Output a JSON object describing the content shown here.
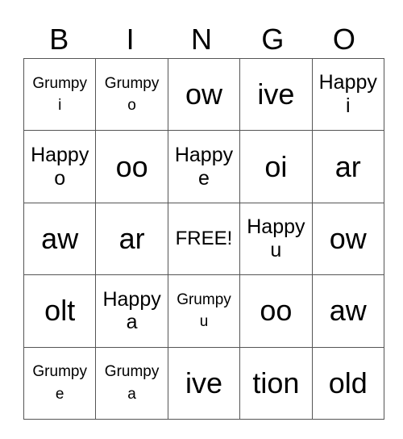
{
  "header": [
    "B",
    "I",
    "N",
    "G",
    "O"
  ],
  "rows": [
    [
      "Grumpy\ni",
      "Grumpy\no",
      "ow",
      "ive",
      "Happy\ni"
    ],
    [
      "Happy\no",
      "oo",
      "Happy\ne",
      "oi",
      "ar"
    ],
    [
      "aw",
      "ar",
      "FREE!",
      "Happy\nu",
      "ow"
    ],
    [
      "olt",
      "Happy\na",
      "Grumpy\nu",
      "oo",
      "aw"
    ],
    [
      "Grumpy\ne",
      "Grumpy\na",
      "ive",
      "tion",
      "old"
    ]
  ]
}
